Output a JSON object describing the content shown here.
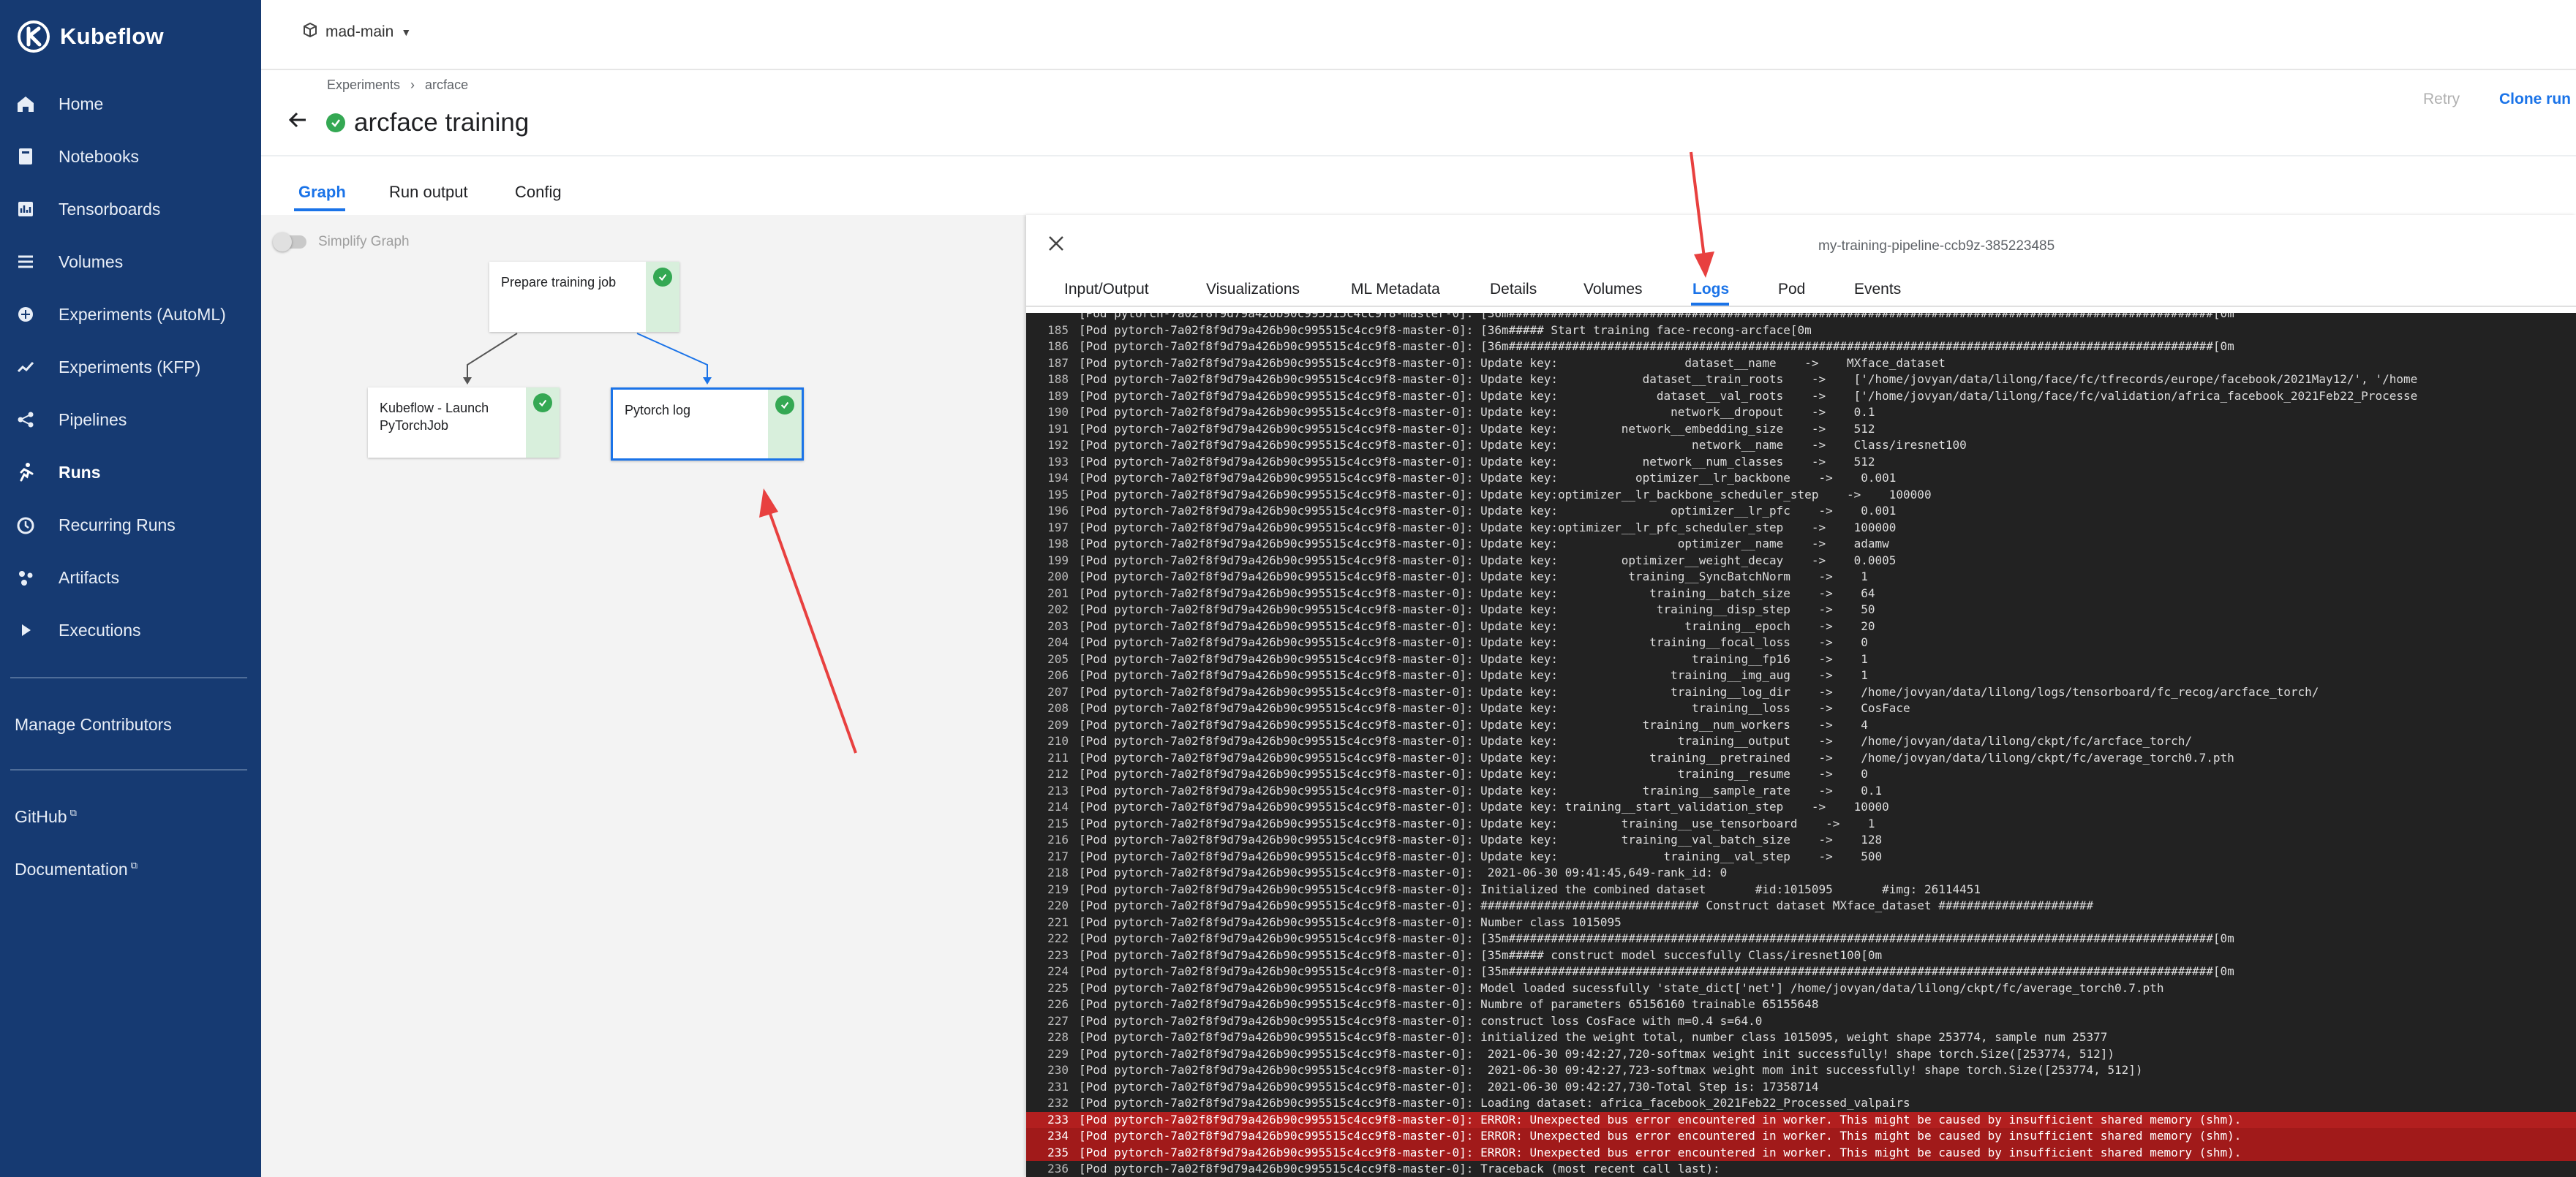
{
  "app": {
    "name": "Kubeflow"
  },
  "namespace": "mad-main",
  "sidebar": {
    "items": [
      {
        "label": "Home",
        "icon": "home-icon"
      },
      {
        "label": "Notebooks",
        "icon": "notebook-icon"
      },
      {
        "label": "Tensorboards",
        "icon": "tensorboard-icon"
      },
      {
        "label": "Volumes",
        "icon": "volumes-icon"
      },
      {
        "label": "Experiments (AutoML)",
        "icon": "automl-icon"
      },
      {
        "label": "Experiments (KFP)",
        "icon": "kfp-icon"
      },
      {
        "label": "Pipelines",
        "icon": "pipelines-icon"
      },
      {
        "label": "Runs",
        "icon": "runs-icon"
      },
      {
        "label": "Recurring Runs",
        "icon": "recurring-runs-icon"
      },
      {
        "label": "Artifacts",
        "icon": "artifacts-icon"
      },
      {
        "label": "Executions",
        "icon": "executions-icon"
      }
    ],
    "manage": "Manage Contributors",
    "github": "GitHub",
    "docs": "Documentation"
  },
  "breadcrumb": [
    "Experiments",
    "arcface"
  ],
  "run": {
    "title": "arcface training",
    "retry": "Retry",
    "clone": "Clone run"
  },
  "main_tabs": [
    "Graph",
    "Run output",
    "Config"
  ],
  "graph": {
    "simplify_label": "Simplify Graph",
    "nodes": {
      "prepare": "Prepare training job",
      "kubeflow_launch": [
        "Kubeflow - Launch",
        "PyTorchJob"
      ],
      "pytorch_log": "Pytorch log"
    }
  },
  "drawer": {
    "run_id": "my-training-pipeline-ccb9z-385223485",
    "tabs": [
      "Input/Output",
      "Visualizations",
      "ML Metadata",
      "Details",
      "Volumes",
      "Logs",
      "Pod",
      "Events"
    ],
    "active_tab": "Logs"
  },
  "logs": [
    {
      "n": "",
      "t": "[Pod pytorch-7a02f8f9d79a426b90c995515c4cc9f8-master-0]: [36m####################################################################################################[0m",
      "cut": true
    },
    {
      "n": "185",
      "t": "[Pod pytorch-7a02f8f9d79a426b90c995515c4cc9f8-master-0]: [36m##### Start training face-recong-arcface[0m"
    },
    {
      "n": "186",
      "t": "[Pod pytorch-7a02f8f9d79a426b90c995515c4cc9f8-master-0]: [36m####################################################################################################[0m"
    },
    {
      "n": "187",
      "t": "[Pod pytorch-7a02f8f9d79a426b90c995515c4cc9f8-master-0]: Update key:                  dataset__name    ->    MXface_dataset"
    },
    {
      "n": "188",
      "t": "[Pod pytorch-7a02f8f9d79a426b90c995515c4cc9f8-master-0]: Update key:            dataset__train_roots    ->    ['/home/jovyan/data/lilong/face/fc/tfrecords/europe/facebook/2021May12/', '/home"
    },
    {
      "n": "189",
      "t": "[Pod pytorch-7a02f8f9d79a426b90c995515c4cc9f8-master-0]: Update key:              dataset__val_roots    ->    ['/home/jovyan/data/lilong/face/fc/validation/africa_facebook_2021Feb22_Processe"
    },
    {
      "n": "190",
      "t": "[Pod pytorch-7a02f8f9d79a426b90c995515c4cc9f8-master-0]: Update key:                network__dropout    ->    0.1"
    },
    {
      "n": "191",
      "t": "[Pod pytorch-7a02f8f9d79a426b90c995515c4cc9f8-master-0]: Update key:         network__embedding_size    ->    512"
    },
    {
      "n": "192",
      "t": "[Pod pytorch-7a02f8f9d79a426b90c995515c4cc9f8-master-0]: Update key:                   network__name    ->    Class/iresnet100"
    },
    {
      "n": "193",
      "t": "[Pod pytorch-7a02f8f9d79a426b90c995515c4cc9f8-master-0]: Update key:            network__num_classes    ->    512"
    },
    {
      "n": "194",
      "t": "[Pod pytorch-7a02f8f9d79a426b90c995515c4cc9f8-master-0]: Update key:           optimizer__lr_backbone    ->    0.001"
    },
    {
      "n": "195",
      "t": "[Pod pytorch-7a02f8f9d79a426b90c995515c4cc9f8-master-0]: Update key:optimizer__lr_backbone_scheduler_step    ->    100000"
    },
    {
      "n": "196",
      "t": "[Pod pytorch-7a02f8f9d79a426b90c995515c4cc9f8-master-0]: Update key:                optimizer__lr_pfc    ->    0.001"
    },
    {
      "n": "197",
      "t": "[Pod pytorch-7a02f8f9d79a426b90c995515c4cc9f8-master-0]: Update key:optimizer__lr_pfc_scheduler_step    ->    100000"
    },
    {
      "n": "198",
      "t": "[Pod pytorch-7a02f8f9d79a426b90c995515c4cc9f8-master-0]: Update key:                 optimizer__name    ->    adamw"
    },
    {
      "n": "199",
      "t": "[Pod pytorch-7a02f8f9d79a426b90c995515c4cc9f8-master-0]: Update key:         optimizer__weight_decay    ->    0.0005"
    },
    {
      "n": "200",
      "t": "[Pod pytorch-7a02f8f9d79a426b90c995515c4cc9f8-master-0]: Update key:          training__SyncBatchNorm    ->    1"
    },
    {
      "n": "201",
      "t": "[Pod pytorch-7a02f8f9d79a426b90c995515c4cc9f8-master-0]: Update key:             training__batch_size    ->    64"
    },
    {
      "n": "202",
      "t": "[Pod pytorch-7a02f8f9d79a426b90c995515c4cc9f8-master-0]: Update key:              training__disp_step    ->    50"
    },
    {
      "n": "203",
      "t": "[Pod pytorch-7a02f8f9d79a426b90c995515c4cc9f8-master-0]: Update key:                  training__epoch    ->    20"
    },
    {
      "n": "204",
      "t": "[Pod pytorch-7a02f8f9d79a426b90c995515c4cc9f8-master-0]: Update key:             training__focal_loss    ->    0"
    },
    {
      "n": "205",
      "t": "[Pod pytorch-7a02f8f9d79a426b90c995515c4cc9f8-master-0]: Update key:                   training__fp16    ->    1"
    },
    {
      "n": "206",
      "t": "[Pod pytorch-7a02f8f9d79a426b90c995515c4cc9f8-master-0]: Update key:                training__img_aug    ->    1"
    },
    {
      "n": "207",
      "t": "[Pod pytorch-7a02f8f9d79a426b90c995515c4cc9f8-master-0]: Update key:                training__log_dir    ->    /home/jovyan/data/lilong/logs/tensorboard/fc_recog/arcface_torch/"
    },
    {
      "n": "208",
      "t": "[Pod pytorch-7a02f8f9d79a426b90c995515c4cc9f8-master-0]: Update key:                   training__loss    ->    CosFace"
    },
    {
      "n": "209",
      "t": "[Pod pytorch-7a02f8f9d79a426b90c995515c4cc9f8-master-0]: Update key:            training__num_workers    ->    4"
    },
    {
      "n": "210",
      "t": "[Pod pytorch-7a02f8f9d79a426b90c995515c4cc9f8-master-0]: Update key:                 training__output    ->    /home/jovyan/data/lilong/ckpt/fc/arcface_torch/"
    },
    {
      "n": "211",
      "t": "[Pod pytorch-7a02f8f9d79a426b90c995515c4cc9f8-master-0]: Update key:             training__pretrained    ->    /home/jovyan/data/lilong/ckpt/fc/average_torch0.7.pth"
    },
    {
      "n": "212",
      "t": "[Pod pytorch-7a02f8f9d79a426b90c995515c4cc9f8-master-0]: Update key:                 training__resume    ->    0"
    },
    {
      "n": "213",
      "t": "[Pod pytorch-7a02f8f9d79a426b90c995515c4cc9f8-master-0]: Update key:            training__sample_rate    ->    0.1"
    },
    {
      "n": "214",
      "t": "[Pod pytorch-7a02f8f9d79a426b90c995515c4cc9f8-master-0]: Update key: training__start_validation_step    ->    10000"
    },
    {
      "n": "215",
      "t": "[Pod pytorch-7a02f8f9d79a426b90c995515c4cc9f8-master-0]: Update key:         training__use_tensorboard    ->    1"
    },
    {
      "n": "216",
      "t": "[Pod pytorch-7a02f8f9d79a426b90c995515c4cc9f8-master-0]: Update key:         training__val_batch_size    ->    128"
    },
    {
      "n": "217",
      "t": "[Pod pytorch-7a02f8f9d79a426b90c995515c4cc9f8-master-0]: Update key:               training__val_step    ->    500"
    },
    {
      "n": "218",
      "t": "[Pod pytorch-7a02f8f9d79a426b90c995515c4cc9f8-master-0]:  2021-06-30 09:41:45,649-rank_id: 0"
    },
    {
      "n": "219",
      "t": "[Pod pytorch-7a02f8f9d79a426b90c995515c4cc9f8-master-0]: Initialized the combined dataset       #id:1015095       #img: 26114451"
    },
    {
      "n": "220",
      "t": "[Pod pytorch-7a02f8f9d79a426b90c995515c4cc9f8-master-0]: ############################### Construct dataset MXface_dataset ######################"
    },
    {
      "n": "221",
      "t": "[Pod pytorch-7a02f8f9d79a426b90c995515c4cc9f8-master-0]: Number class 1015095"
    },
    {
      "n": "222",
      "t": "[Pod pytorch-7a02f8f9d79a426b90c995515c4cc9f8-master-0]: [35m####################################################################################################[0m"
    },
    {
      "n": "223",
      "t": "[Pod pytorch-7a02f8f9d79a426b90c995515c4cc9f8-master-0]: [35m##### construct model succesfully Class/iresnet100[0m"
    },
    {
      "n": "224",
      "t": "[Pod pytorch-7a02f8f9d79a426b90c995515c4cc9f8-master-0]: [35m####################################################################################################[0m"
    },
    {
      "n": "225",
      "t": "[Pod pytorch-7a02f8f9d79a426b90c995515c4cc9f8-master-0]: Model loaded sucessfully 'state_dict['net'] /home/jovyan/data/lilong/ckpt/fc/average_torch0.7.pth"
    },
    {
      "n": "226",
      "t": "[Pod pytorch-7a02f8f9d79a426b90c995515c4cc9f8-master-0]: Numbre of parameters 65156160 trainable 65155648"
    },
    {
      "n": "227",
      "t": "[Pod pytorch-7a02f8f9d79a426b90c995515c4cc9f8-master-0]: construct loss CosFace with m=0.4 s=64.0"
    },
    {
      "n": "228",
      "t": "[Pod pytorch-7a02f8f9d79a426b90c995515c4cc9f8-master-0]: initialized the weight total, number class 1015095, weight shape 253774, sample num 25377"
    },
    {
      "n": "229",
      "t": "[Pod pytorch-7a02f8f9d79a426b90c995515c4cc9f8-master-0]:  2021-06-30 09:42:27,720-softmax weight init successfully! shape torch.Size([253774, 512])"
    },
    {
      "n": "230",
      "t": "[Pod pytorch-7a02f8f9d79a426b90c995515c4cc9f8-master-0]:  2021-06-30 09:42:27,723-softmax weight mom init successfully! shape torch.Size([253774, 512])"
    },
    {
      "n": "231",
      "t": "[Pod pytorch-7a02f8f9d79a426b90c995515c4cc9f8-master-0]:  2021-06-30 09:42:27,730-Total Step is: 17358714"
    },
    {
      "n": "232",
      "t": "[Pod pytorch-7a02f8f9d79a426b90c995515c4cc9f8-master-0]: Loading dataset: africa_facebook_2021Feb22_Processed_valpairs"
    },
    {
      "n": "233",
      "t": "[Pod pytorch-7a02f8f9d79a426b90c995515c4cc9f8-master-0]: ERROR: Unexpected bus error encountered in worker. This might be caused by insufficient shared memory (shm).",
      "err": true,
      "hl": true
    },
    {
      "n": "234",
      "t": "[Pod pytorch-7a02f8f9d79a426b90c995515c4cc9f8-master-0]: ERROR: Unexpected bus error encountered in worker. This might be caused by insufficient shared memory (shm).",
      "err": true
    },
    {
      "n": "235",
      "t": "[Pod pytorch-7a02f8f9d79a426b90c995515c4cc9f8-master-0]: ERROR: Unexpected bus error encountered in worker. This might be caused by insufficient shared memory (shm).",
      "err": true
    },
    {
      "n": "236",
      "t": "[Pod pytorch-7a02f8f9d79a426b90c995515c4cc9f8-master-0]: Traceback (most recent call last):"
    }
  ],
  "colors": {
    "sidebar": "#163a72",
    "accent": "#1a73e8",
    "success": "#34a853",
    "error_row": "#a11a1a",
    "annotation_arrow": "#e8403f"
  }
}
